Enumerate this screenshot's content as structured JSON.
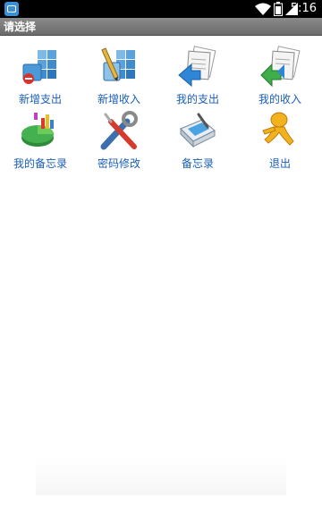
{
  "status_bar": {
    "time": "5:16",
    "icons": [
      "app-icon",
      "wifi-icon",
      "battery-icon",
      "signal-icon"
    ]
  },
  "title_bar": {
    "title": "请选择"
  },
  "menu": {
    "items": [
      {
        "label": "新增支出",
        "icon": "add-expense-icon"
      },
      {
        "label": "新增收入",
        "icon": "add-income-icon"
      },
      {
        "label": "我的支出",
        "icon": "my-expense-icon"
      },
      {
        "label": "我的收入",
        "icon": "my-income-icon"
      },
      {
        "label": "我的备忘录",
        "icon": "my-memo-icon"
      },
      {
        "label": "密码修改",
        "icon": "password-change-icon"
      },
      {
        "label": "备忘录",
        "icon": "memo-icon"
      },
      {
        "label": "退出",
        "icon": "exit-icon"
      }
    ]
  },
  "colors": {
    "label": "#1a5fb4",
    "title_bar": "#7a7a7a",
    "status_bar": "#000000"
  }
}
